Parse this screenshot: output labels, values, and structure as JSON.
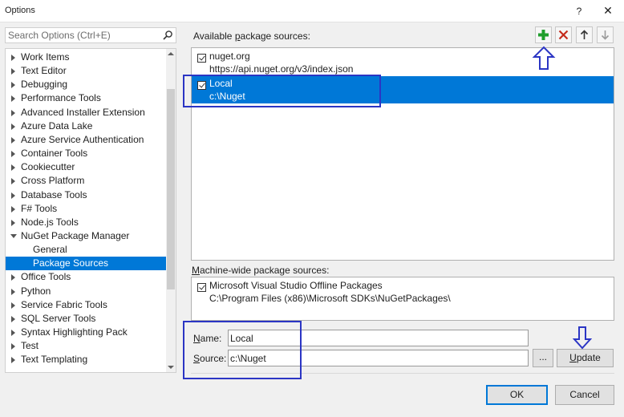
{
  "window": {
    "title": "Options",
    "help_glyph": "?",
    "close_glyph": "✕"
  },
  "search": {
    "placeholder": "Search Options (Ctrl+E)",
    "value": ""
  },
  "tree": {
    "items": [
      {
        "label": "Work Items",
        "expanded": false
      },
      {
        "label": "Text Editor",
        "expanded": false
      },
      {
        "label": "Debugging",
        "expanded": false
      },
      {
        "label": "Performance Tools",
        "expanded": false
      },
      {
        "label": "Advanced Installer Extension",
        "expanded": false
      },
      {
        "label": "Azure Data Lake",
        "expanded": false
      },
      {
        "label": "Azure Service Authentication",
        "expanded": false
      },
      {
        "label": "Container Tools",
        "expanded": false
      },
      {
        "label": "Cookiecutter",
        "expanded": false
      },
      {
        "label": "Cross Platform",
        "expanded": false
      },
      {
        "label": "Database Tools",
        "expanded": false
      },
      {
        "label": "F# Tools",
        "expanded": false
      },
      {
        "label": "Node.js Tools",
        "expanded": false
      },
      {
        "label": "NuGet Package Manager",
        "expanded": true
      },
      {
        "label": "General",
        "child": true
      },
      {
        "label": "Package Sources",
        "child": true,
        "selected": true
      },
      {
        "label": "Office Tools",
        "expanded": false
      },
      {
        "label": "Python",
        "expanded": false
      },
      {
        "label": "Service Fabric Tools",
        "expanded": false
      },
      {
        "label": "SQL Server Tools",
        "expanded": false
      },
      {
        "label": "Syntax Highlighting Pack",
        "expanded": false
      },
      {
        "label": "Test",
        "expanded": false
      },
      {
        "label": "Text Templating",
        "expanded": false
      }
    ]
  },
  "available": {
    "label_pre": "Available ",
    "label_accel": "p",
    "label_post": "ackage sources:",
    "sources": [
      {
        "name": "nuget.org",
        "url": "https://api.nuget.org/v3/index.json",
        "checked": true,
        "selected": false
      },
      {
        "name": "Local",
        "url": "c:\\Nuget",
        "checked": true,
        "selected": true
      }
    ]
  },
  "machine": {
    "label_accel": "M",
    "label_post": "achine-wide package sources:",
    "sources": [
      {
        "name": "Microsoft Visual Studio Offline Packages",
        "url": "C:\\Program Files (x86)\\Microsoft SDKs\\NuGetPackages\\",
        "checked": true
      }
    ]
  },
  "form": {
    "name_accel": "N",
    "name_post": "ame:",
    "name_value": "Local",
    "source_accel": "S",
    "source_post": "ource:",
    "source_value": "c:\\Nuget",
    "browse_label": "...",
    "update_accel": "U",
    "update_post": "pdate"
  },
  "buttons": {
    "ok": "OK",
    "cancel": "Cancel"
  },
  "colors": {
    "selection": "#0078d7",
    "annotation": "#2b35c4",
    "add": "#1f9e2c",
    "remove": "#c42b1c"
  }
}
